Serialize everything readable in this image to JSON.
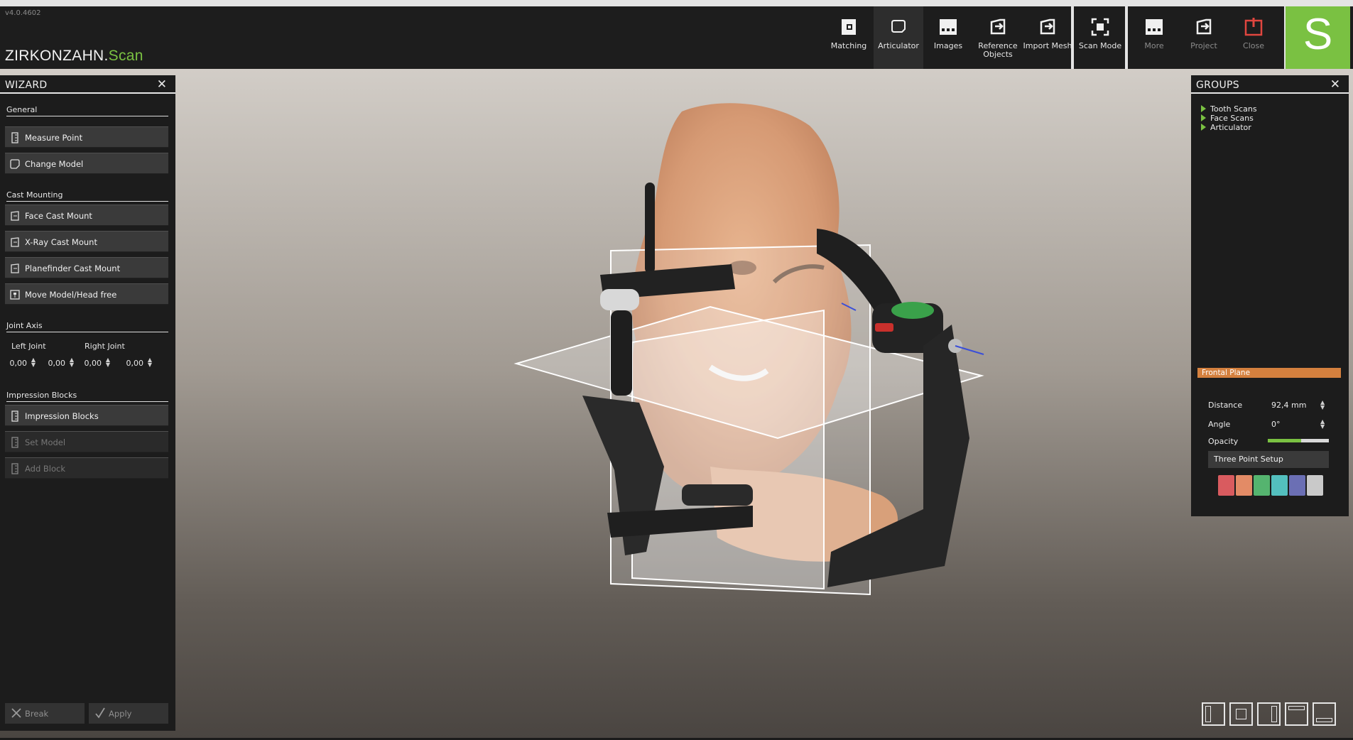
{
  "app": {
    "version": "v4.0.4602",
    "brand_main": "ZIRKONZAHN.",
    "brand_accent": "Scan",
    "logo_letter": "S"
  },
  "toolbar": {
    "items": [
      {
        "label": "Matching",
        "icon": "matching-icon"
      },
      {
        "label": "Articulator",
        "icon": "articulator-icon",
        "active": true
      },
      {
        "label": "Images",
        "icon": "images-icon"
      },
      {
        "label": "Reference\nObjects",
        "icon": "reference-objects-icon"
      },
      {
        "label": "Import Mesh",
        "icon": "import-mesh-icon"
      },
      {
        "label": "Scan Mode",
        "icon": "scan-mode-icon"
      },
      {
        "label": "More",
        "icon": "more-icon"
      },
      {
        "label": "Project",
        "icon": "project-icon"
      },
      {
        "label": "Close",
        "icon": "power-icon"
      }
    ]
  },
  "wizard": {
    "title": "WIZARD",
    "sections": {
      "general": "General",
      "cast_mounting": "Cast Mounting",
      "joint_axis": "Joint Axis",
      "impression_blocks": "Impression Blocks"
    },
    "buttons": {
      "measure_point": "Measure Point",
      "change_model": "Change Model",
      "face_cast_mount": "Face Cast Mount",
      "xray_cast_mount": "X-Ray Cast Mount",
      "planefinder_cast_mount": "Planefinder Cast Mount",
      "move_model": "Move Model/Head free",
      "impression_blocks": "Impression Blocks",
      "set_model": "Set Model",
      "add_block": "Add Block"
    },
    "joint": {
      "left_label": "Left Joint",
      "right_label": "Right Joint",
      "left_values": [
        "0,00",
        "0,00"
      ],
      "right_values": [
        "0,00",
        "0,00"
      ]
    },
    "footer": {
      "break": "Break",
      "apply": "Apply"
    }
  },
  "groups": {
    "title": "GROUPS",
    "items": [
      "Tooth Scans",
      "Face Scans",
      "Articulator"
    ],
    "plane": {
      "name": "Frontal Plane",
      "distance_label": "Distance",
      "distance_value": "92,4 mm",
      "angle_label": "Angle",
      "angle_value": "0°",
      "opacity_label": "Opacity",
      "opacity_level": 0.55,
      "three_point": "Three Point Setup",
      "swatches": [
        "#d95b5f",
        "#e38b66",
        "#55b46f",
        "#53bfbe",
        "#6b6fb4",
        "#c9c9c9"
      ]
    }
  },
  "colors": {
    "accent_green": "#7ac142",
    "plane_orange": "#d4803e",
    "close_red": "#e0463f"
  },
  "view_buttons": [
    "view-left-icon",
    "view-front-icon",
    "view-right-icon",
    "view-top-icon",
    "view-bottom-icon"
  ]
}
